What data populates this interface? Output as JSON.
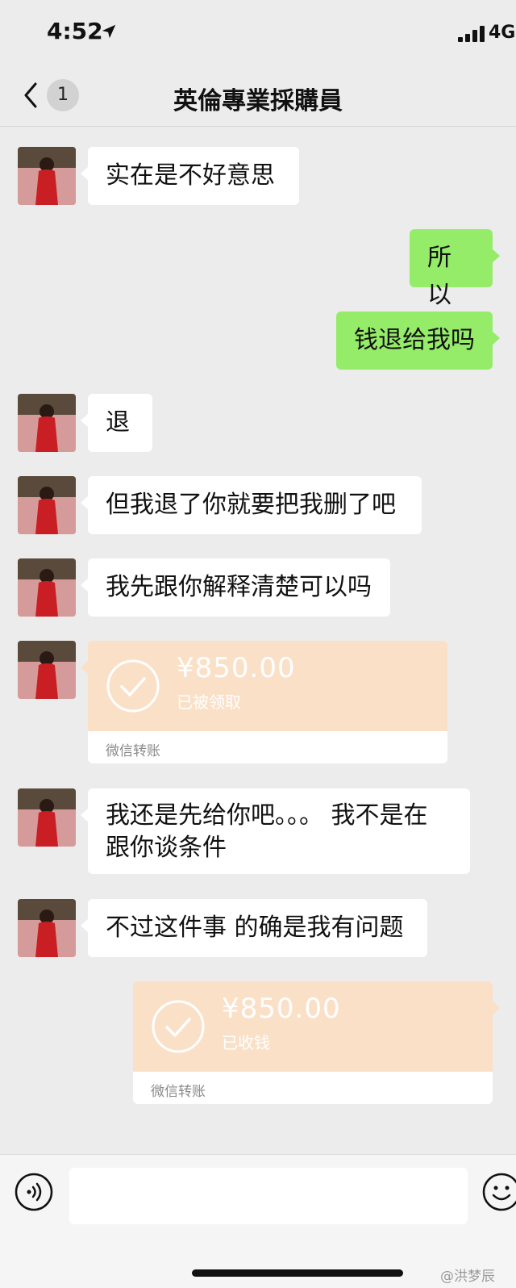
{
  "status_bar": {
    "time": "4:52",
    "network": "4G"
  },
  "nav": {
    "unread_count": "1",
    "title": "英倫專業採購員"
  },
  "messages": {
    "m1": "实在是不好意思",
    "m2": "所以",
    "m3": "钱退给我吗",
    "m4": "退",
    "m5": "但我退了你就要把我删了吧",
    "m6": "我先跟你解释清楚可以吗",
    "t1": {
      "amount": "¥850.00",
      "status": "已被领取",
      "footer": "微信转账"
    },
    "m7_line1": "我还是先给你吧。。。 我不是在",
    "m7_line2": "跟你谈条件",
    "m8": "不过这件事 的确是我有问题",
    "t2": {
      "amount": "¥850.00",
      "status": "已收钱",
      "footer": "微信转账"
    }
  },
  "watermark": "@洪梦辰",
  "icons": [
    "location-arrow-icon",
    "signal-icon",
    "back-chevron-icon",
    "check-circle-icon",
    "voice-icon",
    "emoji-icon"
  ],
  "colors": {
    "background": "#ececec",
    "outgoing_bubble": "#95ec69",
    "incoming_bubble": "#ffffff",
    "transfer": "#fbe0c8"
  }
}
